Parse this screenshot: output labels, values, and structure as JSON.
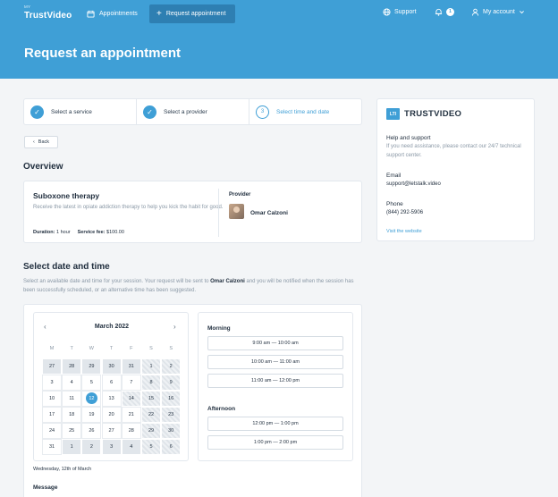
{
  "header": {
    "brand_small": "MY",
    "brand": "TrustVideo",
    "nav": [
      {
        "label": "Appointments",
        "icon": "calendar-icon"
      },
      {
        "label": "Request appointment",
        "icon": "plus-icon"
      }
    ],
    "support_label": "Support",
    "notifications_count": "1",
    "account_label": "My account"
  },
  "page": {
    "title": "Request an appointment"
  },
  "stepper": {
    "steps": [
      {
        "label": "Select a service",
        "state": "done"
      },
      {
        "label": "Select a provider",
        "state": "done"
      },
      {
        "label": "Select time and date",
        "state": "current",
        "number": "3"
      }
    ]
  },
  "back_label": "Back",
  "overview": {
    "heading": "Overview",
    "service_title": "Suboxone therapy",
    "description": "Receive the latest in opiate addiction therapy to help you kick the habit for good.",
    "duration_label": "Duration:",
    "duration_value": "1 hour",
    "fee_label": "Service fee:",
    "fee_value": "$100.00",
    "provider_label": "Provider",
    "provider_name": "Omar Calzoni"
  },
  "support": {
    "logo_text": "TRUSTVIDEO",
    "logo_mark": "LTI",
    "help_heading": "Help and support",
    "help_text": "If you need assistance, please contact our 24/7 technical support center.",
    "email_label": "Email",
    "email_value": "support@letstalk.video",
    "phone_label": "Phone",
    "phone_value": "(844) 292-5906",
    "link_label": "Visit the website"
  },
  "schedule": {
    "heading": "Select date and time",
    "desc_before": "Select an available date and time for your session. Your request will be sent to ",
    "desc_name": "Omar Calzoni",
    "desc_after": " and you will be notified when the session has been successfully scheduled, or an alternative time has been suggested.",
    "calendar": {
      "month": "March 2022",
      "weekdays": [
        "M",
        "T",
        "W",
        "T",
        "F",
        "S",
        "S"
      ],
      "weeks": [
        [
          {
            "d": "27",
            "t": "out"
          },
          {
            "d": "28",
            "t": "out"
          },
          {
            "d": "29",
            "t": "out"
          },
          {
            "d": "30",
            "t": "out"
          },
          {
            "d": "31",
            "t": "out"
          },
          {
            "d": "1",
            "t": "hatch"
          },
          {
            "d": "2",
            "t": "hatch"
          }
        ],
        [
          {
            "d": "3",
            "t": "in"
          },
          {
            "d": "4",
            "t": "in"
          },
          {
            "d": "5",
            "t": "in"
          },
          {
            "d": "6",
            "t": "in"
          },
          {
            "d": "7",
            "t": "in"
          },
          {
            "d": "8",
            "t": "hatch"
          },
          {
            "d": "9",
            "t": "hatch"
          }
        ],
        [
          {
            "d": "10",
            "t": "in"
          },
          {
            "d": "11",
            "t": "in"
          },
          {
            "d": "12",
            "t": "sel"
          },
          {
            "d": "13",
            "t": "in"
          },
          {
            "d": "14",
            "t": "hatch"
          },
          {
            "d": "15",
            "t": "hatch"
          },
          {
            "d": "16",
            "t": "hatch"
          }
        ],
        [
          {
            "d": "17",
            "t": "in"
          },
          {
            "d": "18",
            "t": "in"
          },
          {
            "d": "19",
            "t": "in"
          },
          {
            "d": "20",
            "t": "in"
          },
          {
            "d": "21",
            "t": "in"
          },
          {
            "d": "22",
            "t": "hatch"
          },
          {
            "d": "23",
            "t": "hatch"
          }
        ],
        [
          {
            "d": "24",
            "t": "in"
          },
          {
            "d": "25",
            "t": "in"
          },
          {
            "d": "26",
            "t": "in"
          },
          {
            "d": "27",
            "t": "in"
          },
          {
            "d": "28",
            "t": "in"
          },
          {
            "d": "29",
            "t": "hatch"
          },
          {
            "d": "30",
            "t": "hatch"
          }
        ],
        [
          {
            "d": "31",
            "t": "in"
          },
          {
            "d": "1",
            "t": "out"
          },
          {
            "d": "2",
            "t": "out"
          },
          {
            "d": "3",
            "t": "out"
          },
          {
            "d": "4",
            "t": "out"
          },
          {
            "d": "5",
            "t": "hatch"
          },
          {
            "d": "6",
            "t": "hatch"
          }
        ]
      ]
    },
    "selected_date_text": "Wednesday, 12th of March",
    "message_label": "Message",
    "morning_label": "Morning",
    "morning_slots": [
      "9:00 am — 10:00 am",
      "10:00 am — 11:00 am",
      "11:00 am — 12:00 pm"
    ],
    "afternoon_label": "Afternoon",
    "afternoon_slots": [
      "12:00 pm — 1:00 pm",
      "1:00 pm — 2:00 pm"
    ]
  },
  "colors": {
    "primary": "#3f9fd6",
    "nav_active": "#2e7fb2",
    "page_bg": "#f3f5f7"
  }
}
